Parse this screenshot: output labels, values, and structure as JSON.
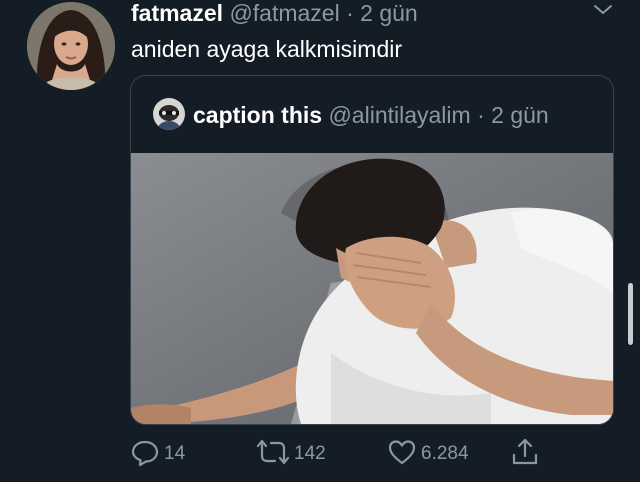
{
  "tweet": {
    "author": {
      "display_name": "fatmazel",
      "handle": "@fatmazel",
      "separator": "·",
      "time": "2 gün"
    },
    "text": "aniden ayaga kalkmisimdir",
    "quoted": {
      "display_name": "caption this",
      "handle": "@alintilayalim",
      "separator": "·",
      "time": "2 gün"
    },
    "actions": {
      "reply_count": "14",
      "retweet_count": "142",
      "like_count": "6.284"
    }
  },
  "icons": {
    "more": "chevron-down-icon",
    "reply": "speech-bubble-icon",
    "retweet": "retweet-arrows-icon",
    "like": "heart-icon",
    "share": "share-upload-icon"
  },
  "colors": {
    "background": "#141d26",
    "secondary_text": "#8899a6",
    "border": "#38444d"
  }
}
